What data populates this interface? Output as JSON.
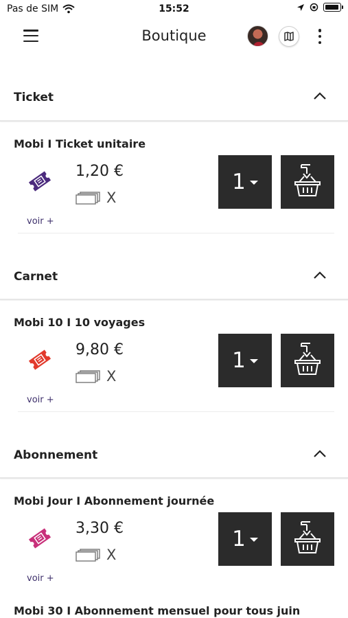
{
  "status_bar": {
    "carrier": "Pas de SIM",
    "time": "15:52"
  },
  "header": {
    "title": "Boutique"
  },
  "sections": [
    {
      "label": "Ticket",
      "product": {
        "name": "Mobi I Ticket unitaire",
        "price": "1,20 €",
        "count": "X",
        "more": "voir +",
        "quantity": "1",
        "icon_color": "#4b2a7d"
      }
    },
    {
      "label": "Carnet",
      "product": {
        "name": "Mobi 10 I 10 voyages",
        "price": "9,80 €",
        "count": "X",
        "more": "voir +",
        "quantity": "1",
        "icon_color": "#e23a2c"
      }
    },
    {
      "label": "Abonnement",
      "product": {
        "name": "Mobi Jour I Abonnement journée",
        "price": "3,30 €",
        "count": "X",
        "more": "voir +",
        "quantity": "1",
        "icon_color": "#c8307a"
      }
    }
  ],
  "next_product": {
    "name": "Mobi 30 I Abonnement mensuel pour tous juin"
  },
  "icons": {
    "menu": "hamburger-icon",
    "map": "map-icon",
    "more": "more-vertical-icon",
    "section_toggle": "chevron-up-icon",
    "ticket": "ticket-icon",
    "cards": "cards-icon",
    "basket": "add-to-basket-icon",
    "dropdown": "caret-down-icon"
  }
}
